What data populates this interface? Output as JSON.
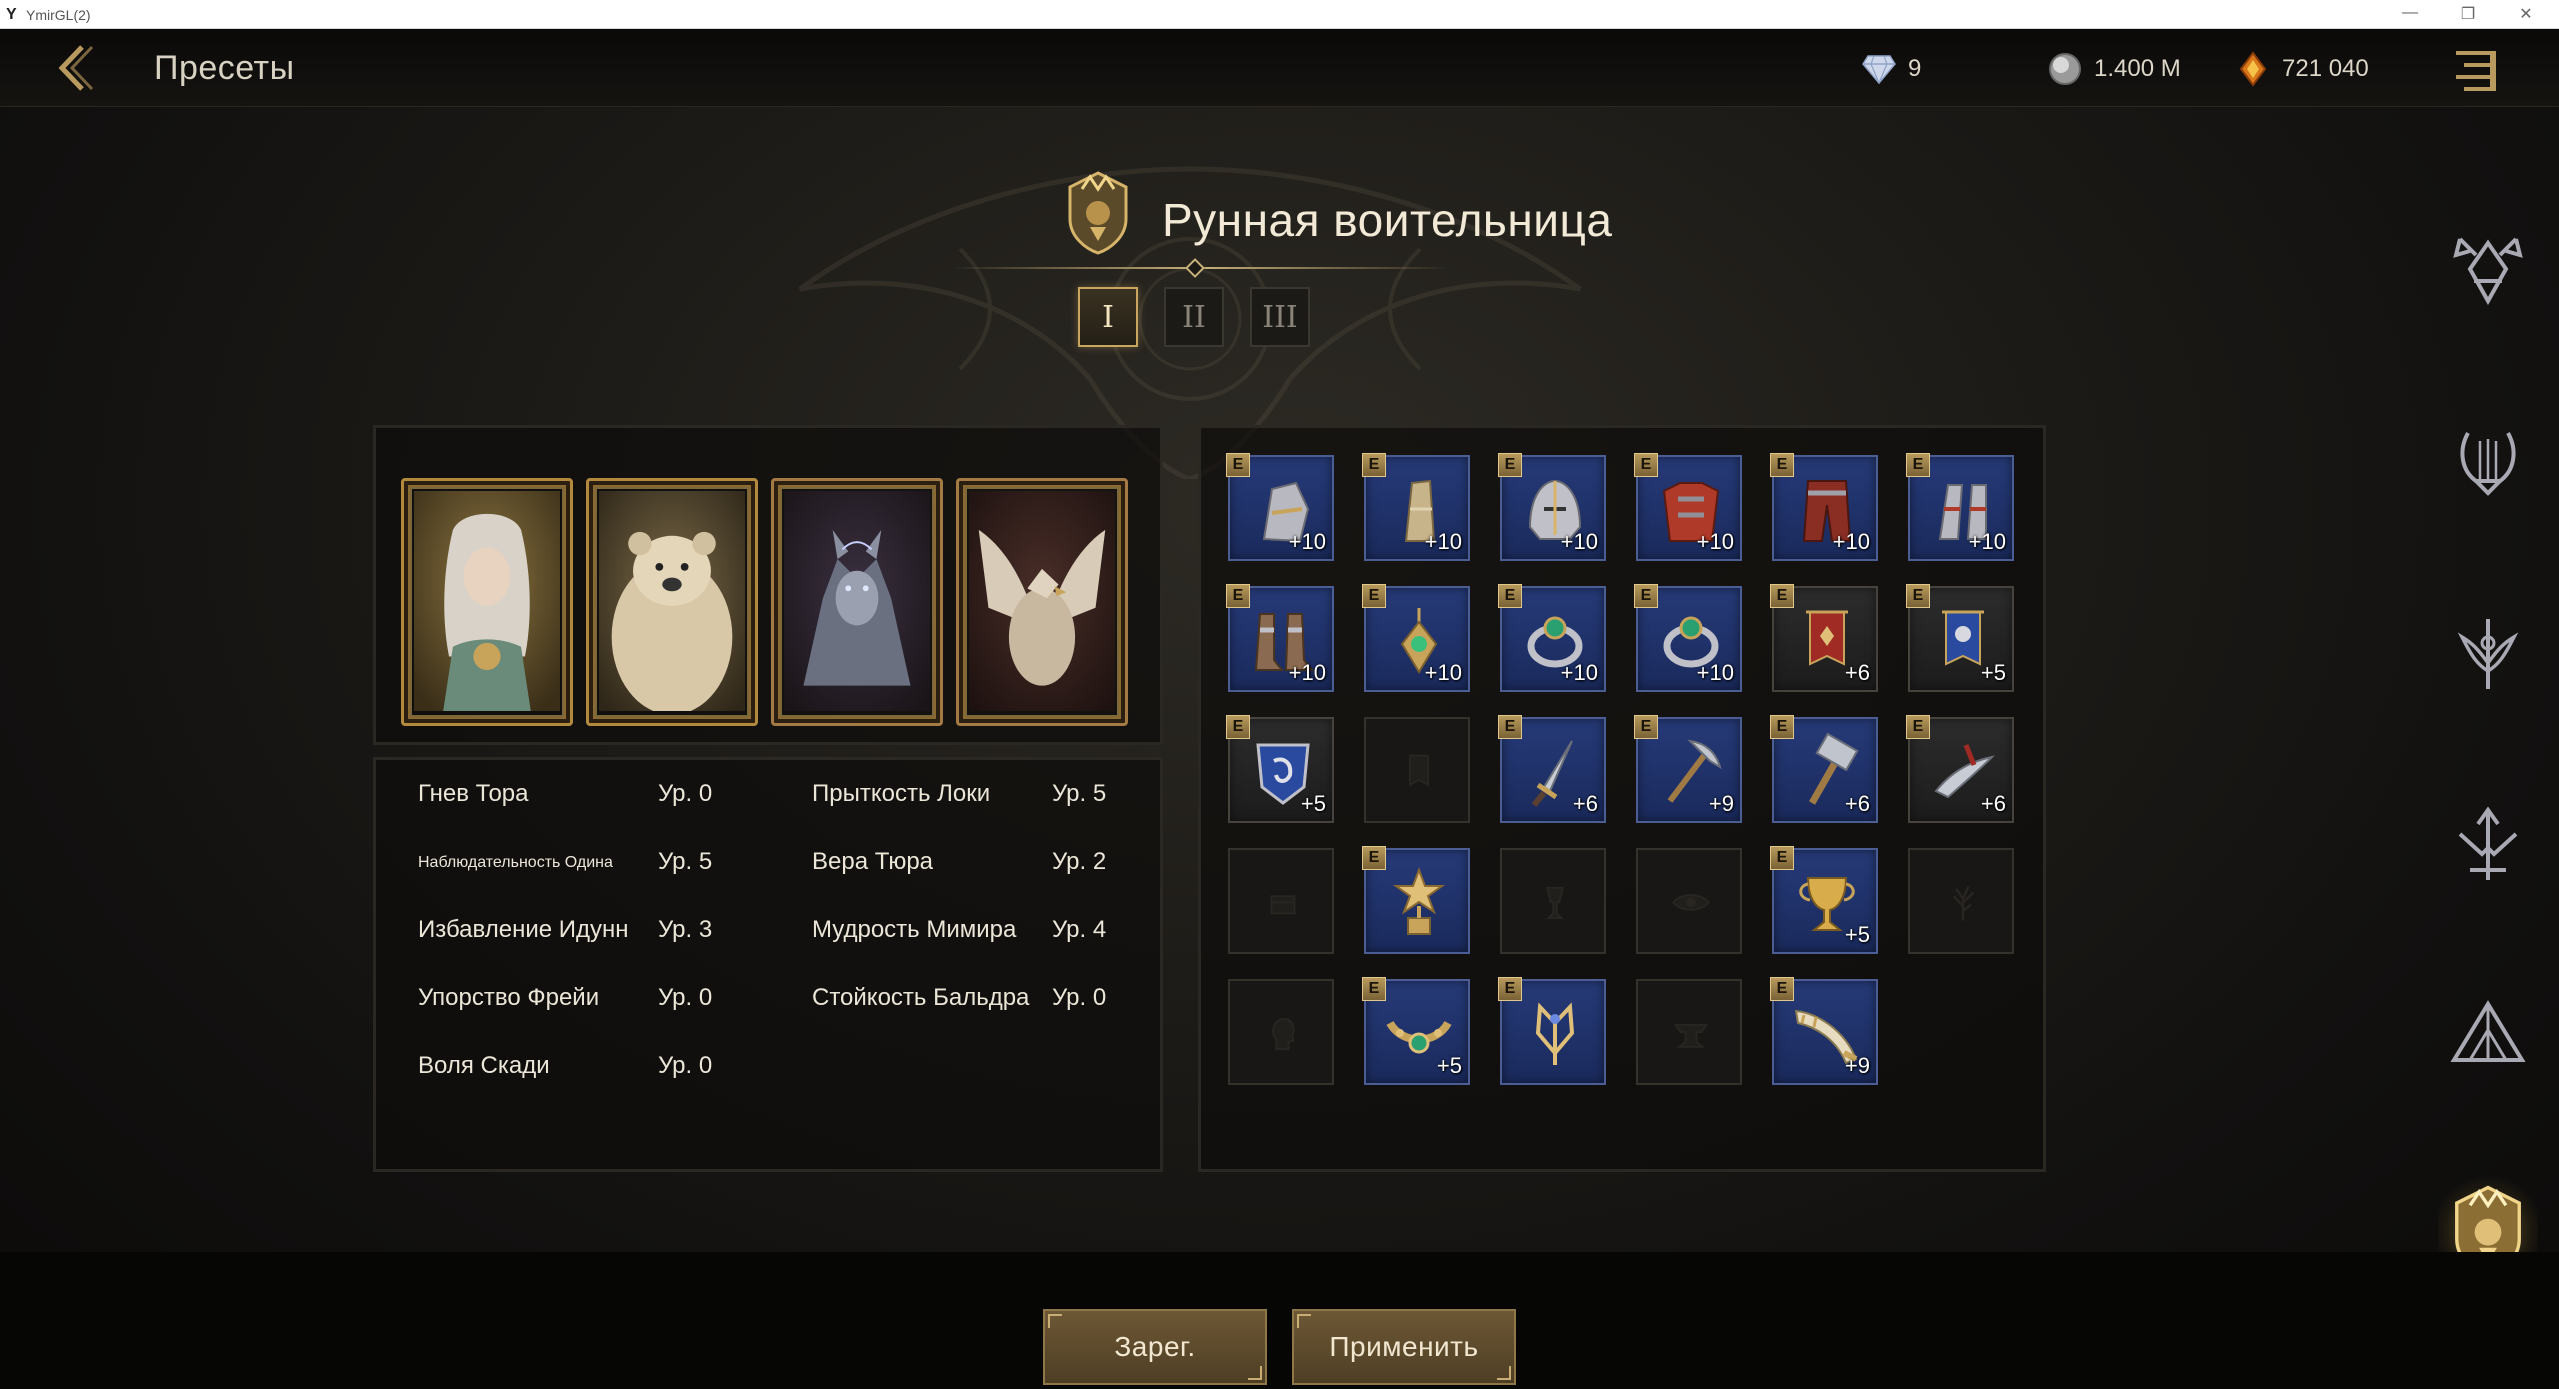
{
  "window": {
    "title": "YmirGL(2)"
  },
  "topbar": {
    "title": "Пресеты",
    "currencies": [
      {
        "name": "diamond-icon",
        "value": "9"
      },
      {
        "name": "silver-coin-icon",
        "value": "1.400 M"
      },
      {
        "name": "amber-gem-icon",
        "value": "721 040"
      }
    ]
  },
  "header": {
    "class_name": "Рунная воительница",
    "preset_tabs": [
      "I",
      "II",
      "III"
    ],
    "active_tab": 0
  },
  "cards": [
    {
      "name": "card-valkyrie-woman"
    },
    {
      "name": "card-polar-bear"
    },
    {
      "name": "card-wolf"
    },
    {
      "name": "card-griffin"
    }
  ],
  "stats": [
    {
      "name": "Гнев Тора",
      "level": "Ур. 0"
    },
    {
      "name": "Наблюдательность Одина",
      "level": "Ур. 5"
    },
    {
      "name": "Избавление Идунн",
      "level": "Ур. 3"
    },
    {
      "name": "Упорство Фрейи",
      "level": "Ур. 0"
    },
    {
      "name": "Воля Скади",
      "level": "Ур. 0"
    },
    {
      "name": "Прыткость Локи",
      "level": "Ур. 5"
    },
    {
      "name": "Вера Тюра",
      "level": "Ур. 2"
    },
    {
      "name": "Мудрость Мимира",
      "level": "Ур. 4"
    },
    {
      "name": "Стойкость Бальдра",
      "level": "Ур. 0"
    }
  ],
  "equipment": [
    {
      "slot": "gloves",
      "icon": "gauntlet-icon",
      "equipped": true,
      "enh": "+10",
      "tint": "blue"
    },
    {
      "slot": "leg-armor",
      "icon": "bracer-icon",
      "equipped": true,
      "enh": "+10",
      "tint": "blue"
    },
    {
      "slot": "helmet",
      "icon": "helmet-icon",
      "equipped": true,
      "enh": "+10",
      "tint": "blue"
    },
    {
      "slot": "chest",
      "icon": "chest-armor-icon",
      "equipped": true,
      "enh": "+10",
      "tint": "blue"
    },
    {
      "slot": "pants",
      "icon": "pants-icon",
      "equipped": true,
      "enh": "+10",
      "tint": "blue"
    },
    {
      "slot": "bracers",
      "icon": "vambrace-icon",
      "equipped": true,
      "enh": "+10",
      "tint": "blue"
    },
    {
      "slot": "boots",
      "icon": "boots-icon",
      "equipped": true,
      "enh": "+10",
      "tint": "blue"
    },
    {
      "slot": "necklace",
      "icon": "pendant-icon",
      "equipped": true,
      "enh": "+10",
      "tint": "blue"
    },
    {
      "slot": "ring-1",
      "icon": "ring-icon",
      "equipped": true,
      "enh": "+10",
      "tint": "blue"
    },
    {
      "slot": "ring-2",
      "icon": "ring-icon",
      "equipped": true,
      "enh": "+10",
      "tint": "blue"
    },
    {
      "slot": "banner-red",
      "icon": "red-banner-icon",
      "equipped": true,
      "enh": "+6",
      "tint": "dark"
    },
    {
      "slot": "banner-blue",
      "icon": "blue-banner-icon",
      "equipped": true,
      "enh": "+5",
      "tint": "dark"
    },
    {
      "slot": "crest",
      "icon": "shield-crest-icon",
      "equipped": true,
      "enh": "+5",
      "tint": "dark"
    },
    {
      "slot": "empty-banner",
      "icon": "banner-outline-icon",
      "equipped": false,
      "enh": "",
      "tint": "empty"
    },
    {
      "slot": "dagger",
      "icon": "dagger-icon",
      "equipped": true,
      "enh": "+6",
      "tint": "blue"
    },
    {
      "slot": "pickaxe",
      "icon": "pickaxe-icon",
      "equipped": true,
      "enh": "+9",
      "tint": "blue"
    },
    {
      "slot": "hammer",
      "icon": "hammer-icon",
      "equipped": true,
      "enh": "+6",
      "tint": "blue"
    },
    {
      "slot": "relic",
      "icon": "curved-blade-icon",
      "equipped": true,
      "enh": "+6",
      "tint": "dark"
    },
    {
      "slot": "empty-chest",
      "icon": "treasure-chest-icon",
      "equipped": false,
      "enh": "",
      "tint": "empty"
    },
    {
      "slot": "trophy",
      "icon": "star-trophy-icon",
      "equipped": true,
      "enh": "",
      "tint": "blue"
    },
    {
      "slot": "empty-chalice",
      "icon": "chalice-outline-icon",
      "equipped": false,
      "enh": "",
      "tint": "empty"
    },
    {
      "slot": "empty-eye",
      "icon": "eye-outline-icon",
      "equipped": false,
      "enh": "",
      "tint": "empty"
    },
    {
      "slot": "goblet",
      "icon": "golden-goblet-icon",
      "equipped": true,
      "enh": "+5",
      "tint": "blue"
    },
    {
      "slot": "empty-tree",
      "icon": "tree-outline-icon",
      "equipped": false,
      "enh": "",
      "tint": "empty"
    },
    {
      "slot": "empty-head",
      "icon": "head-outline-icon",
      "equipped": false,
      "enh": "",
      "tint": "empty"
    },
    {
      "slot": "belt",
      "icon": "belt-icon",
      "equipped": true,
      "enh": "+5",
      "tint": "blue"
    },
    {
      "slot": "totem",
      "icon": "totem-icon",
      "equipped": true,
      "enh": "",
      "tint": "blue"
    },
    {
      "slot": "empty-anvil",
      "icon": "anvil-outline-icon",
      "equipped": false,
      "enh": "",
      "tint": "empty"
    },
    {
      "slot": "horn",
      "icon": "horn-icon",
      "equipped": true,
      "enh": "+9",
      "tint": "blue"
    }
  ],
  "side_nav": [
    {
      "name": "side-nav-warrior-icon"
    },
    {
      "name": "side-nav-lyre-icon"
    },
    {
      "name": "side-nav-sword-emblem-icon"
    },
    {
      "name": "side-nav-spear-icon"
    },
    {
      "name": "side-nav-mountain-icon"
    },
    {
      "name": "side-nav-rune-warrior-icon"
    }
  ],
  "buttons": {
    "register": "Зарег.",
    "apply": "Применить"
  }
}
